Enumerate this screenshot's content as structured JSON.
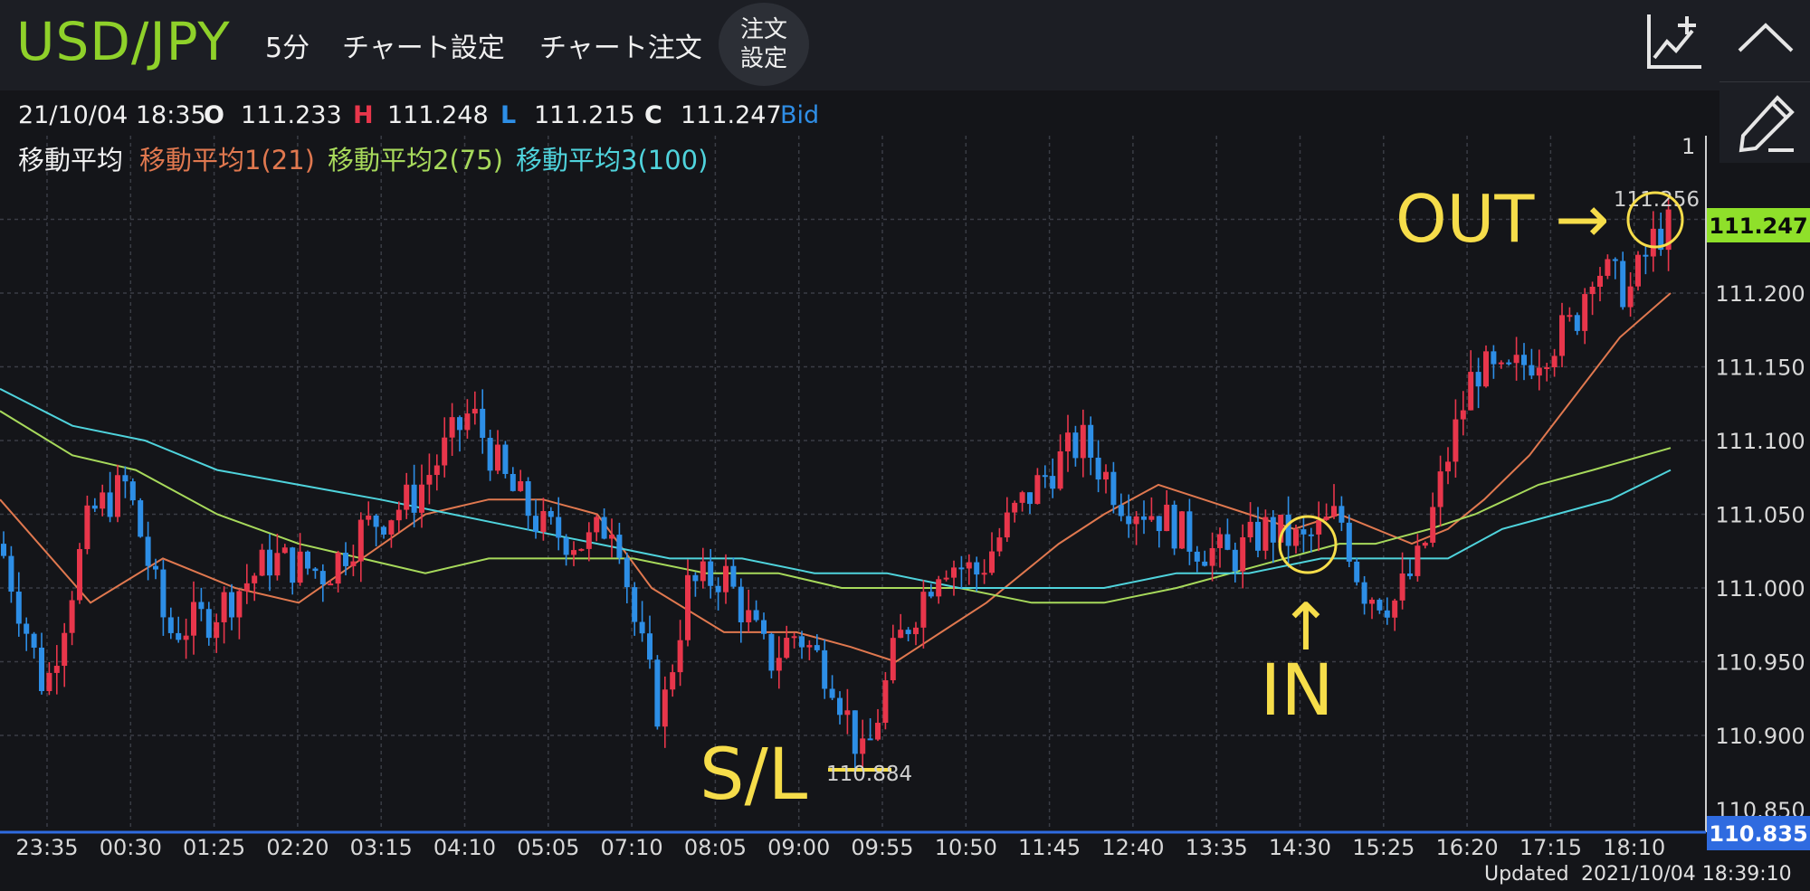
{
  "header": {
    "pair": "USD/JPY",
    "timeframe": "5分",
    "chart_settings": "チャート設定",
    "chart_order": "チャート注文",
    "order_settings_line1": "注文",
    "order_settings_line2": "設定"
  },
  "ohlc": {
    "datetime": "21/10/04 18:35",
    "o_label": "O",
    "o_value": "111.233",
    "h_label": "H",
    "h_value": "111.248",
    "l_label": "L",
    "l_value": "111.215",
    "c_label": "C",
    "c_value": "111.247",
    "price_type": "Bid"
  },
  "indicators": {
    "title": "移動平均",
    "ma1": "移動平均1(21)",
    "ma2": "移動平均2(75)",
    "ma3": "移動平均3(100)"
  },
  "colors": {
    "up": "#e8364b",
    "down": "#2d8ee6",
    "ma1": "#e0784f",
    "ma2": "#a7d95b",
    "ma3": "#4fd3dc",
    "annotation": "#f6dd4a",
    "pair": "#8fd12a",
    "bid": "#2f8ee6",
    "current_price_bg": "#8fe02a",
    "low_price_bg": "#2f6be0"
  },
  "icons": {
    "add_indicator": "chart-add-icon",
    "collapse": "chevron-up-icon",
    "draw": "pencil-icon"
  },
  "chart_data": {
    "type": "candlestick",
    "y_ticks": [
      "111.200",
      "111.150",
      "111.100",
      "111.050",
      "111.000",
      "110.950",
      "110.900"
    ],
    "y_top_partial": "1",
    "y_bottom_partial": "110.850",
    "ylim": [
      110.838,
      111.303
    ],
    "x_ticks": [
      "23:35",
      "00:30",
      "01:25",
      "02:20",
      "03:15",
      "04:10",
      "05:05",
      "07:10",
      "08:05",
      "09:00",
      "09:55",
      "10:50",
      "11:45",
      "12:40",
      "13:35",
      "14:30",
      "15:25",
      "16:20",
      "17:15",
      "18:10"
    ],
    "current_price": "111.247",
    "lowest_price_label": "110.835",
    "high_marker": "111.256",
    "low_marker": "110.884",
    "series": [
      {
        "name": "移動平均1(21)",
        "y_start": 111.06,
        "y_end": 111.2
      },
      {
        "name": "移動平均2(75)",
        "y_start": 111.12,
        "y_end": 111.095
      },
      {
        "name": "移動平均3(100)",
        "y_start": 111.135,
        "y_end": 111.08
      }
    ],
    "annotations": {
      "out": "OUT →",
      "in_arrow": "↑",
      "in": "IN",
      "sl": "S/L"
    }
  },
  "footer": {
    "updated": "Updated",
    "datetime": "2021/10/04  18:39:10"
  }
}
